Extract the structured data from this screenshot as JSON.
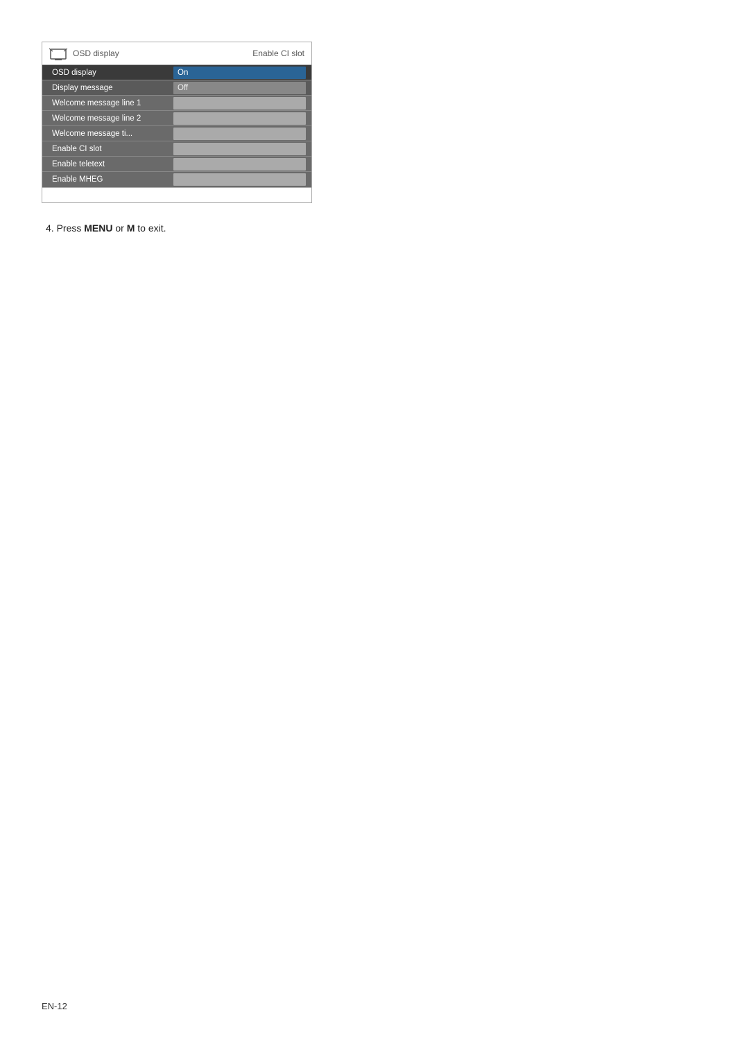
{
  "menu": {
    "header": {
      "title": "OSD display",
      "subtitle": "Enable CI slot"
    },
    "rows": [
      {
        "label": "OSD display",
        "value": "On",
        "style": "on-val",
        "selected": true,
        "active": false
      },
      {
        "label": "Display message",
        "value": "Off",
        "style": "off-val",
        "selected": false,
        "active": true
      },
      {
        "label": "Welcome message line 1",
        "value": "",
        "style": "empty-val",
        "selected": false,
        "active": false
      },
      {
        "label": "Welcome message line 2",
        "value": "",
        "style": "empty-val",
        "selected": false,
        "active": false
      },
      {
        "label": "Welcome message ti...",
        "value": "",
        "style": "empty-val",
        "selected": false,
        "active": false
      },
      {
        "label": "Enable CI slot",
        "value": "",
        "style": "empty-val",
        "selected": false,
        "active": false
      },
      {
        "label": "Enable teletext",
        "value": "",
        "style": "empty-val",
        "selected": false,
        "active": false
      },
      {
        "label": "Enable MHEG",
        "value": "",
        "style": "empty-val",
        "selected": false,
        "active": false
      }
    ]
  },
  "step": {
    "number": "4.",
    "text_before": "Press ",
    "bold1": "MENU",
    "text_mid": " or ",
    "bold2": "M",
    "text_after": " to exit."
  },
  "footer": {
    "page_number": "EN-12"
  }
}
